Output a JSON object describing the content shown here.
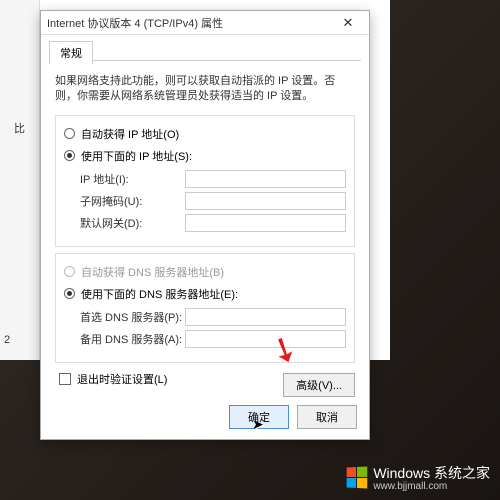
{
  "window": {
    "title": "Internet 协议版本 4 (TCP/IPv4) 属性",
    "close": "✕"
  },
  "tab": {
    "general": "常规"
  },
  "description": "如果网络支持此功能，则可以获取自动指派的 IP 设置。否则，你需要从网络系统管理员处获得适当的 IP 设置。",
  "ip": {
    "auto": "自动获得 IP 地址(O)",
    "manual": "使用下面的 IP 地址(S):",
    "address": "IP 地址(I):",
    "subnet": "子网掩码(U):",
    "gateway": "默认网关(D):"
  },
  "dns": {
    "auto": "自动获得 DNS 服务器地址(B)",
    "manual": "使用下面的 DNS 服务器地址(E):",
    "preferred": "首选 DNS 服务器(P):",
    "alternate": "备用 DNS 服务器(A):"
  },
  "validate": "退出时验证设置(L)",
  "buttons": {
    "advanced": "高级(V)...",
    "ok": "确定",
    "cancel": "取消"
  },
  "watermark": {
    "brand": "Windows",
    "sub": "系统之家",
    "url": "www.bjjmall.com"
  },
  "left": {
    "label": "比",
    "num": "2"
  }
}
